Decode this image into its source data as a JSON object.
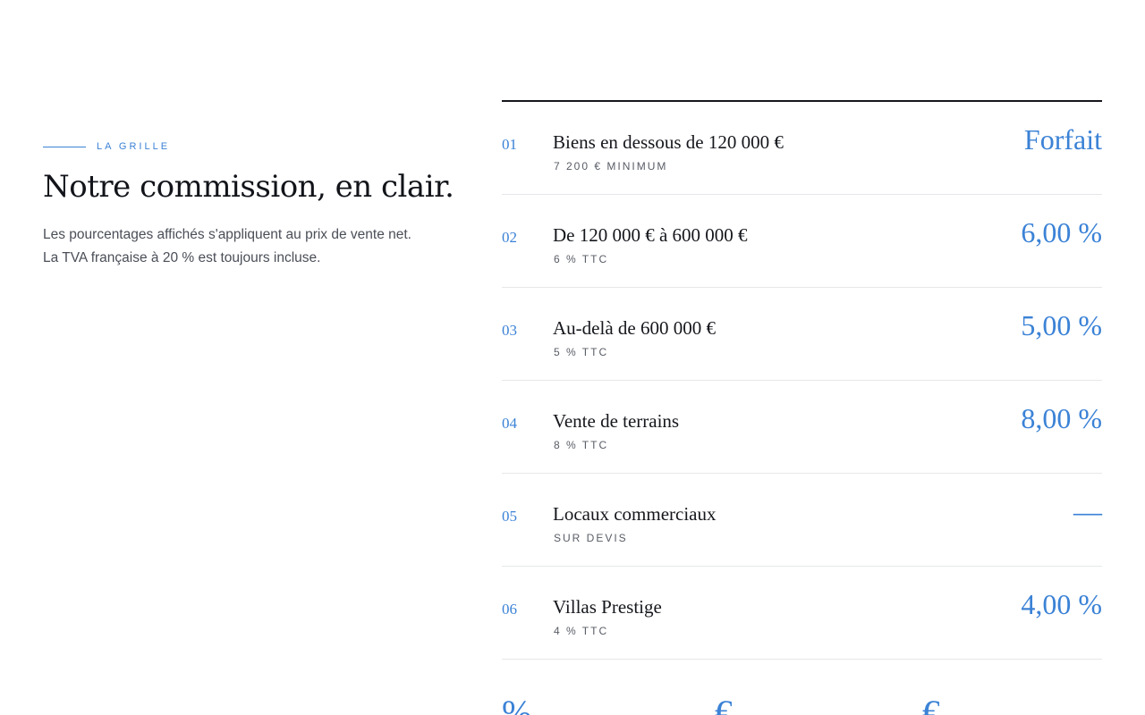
{
  "section": {
    "eyebrow": "LA GRILLE",
    "title": "Notre commission, en clair.",
    "description": [
      "Les pourcentages affichés s'appliquent au prix de vente net.",
      "La TVA française à 20 % est toujours incluse."
    ]
  },
  "rows": [
    {
      "num": "01",
      "label": "Biens en dessous de 120 000 €",
      "sub": "7 200 € MINIMUM",
      "value": "Forfait"
    },
    {
      "num": "02",
      "label": "De 120 000 € à 600 000 €",
      "sub": "6 % TTC",
      "value": "6,00 %"
    },
    {
      "num": "03",
      "label": "Au-delà de 600 000 €",
      "sub": "5 % TTC",
      "value": "5,00 %"
    },
    {
      "num": "04",
      "label": "Vente de terrains",
      "sub": "8 % TTC",
      "value": "8,00 %"
    },
    {
      "num": "05",
      "label": "Locaux commerciaux",
      "sub": "SUR DEVIS",
      "value": "—"
    },
    {
      "num": "06",
      "label": "Villas Prestige",
      "sub": "4 % TTC",
      "value": "4,00 %"
    }
  ],
  "partial_row": {
    "glyphs": [
      "%",
      "€",
      "€"
    ]
  },
  "colors": {
    "accent": "#3b82d6",
    "text": "#15171c",
    "muted": "#585c65",
    "divider": "#e6e7ea"
  }
}
